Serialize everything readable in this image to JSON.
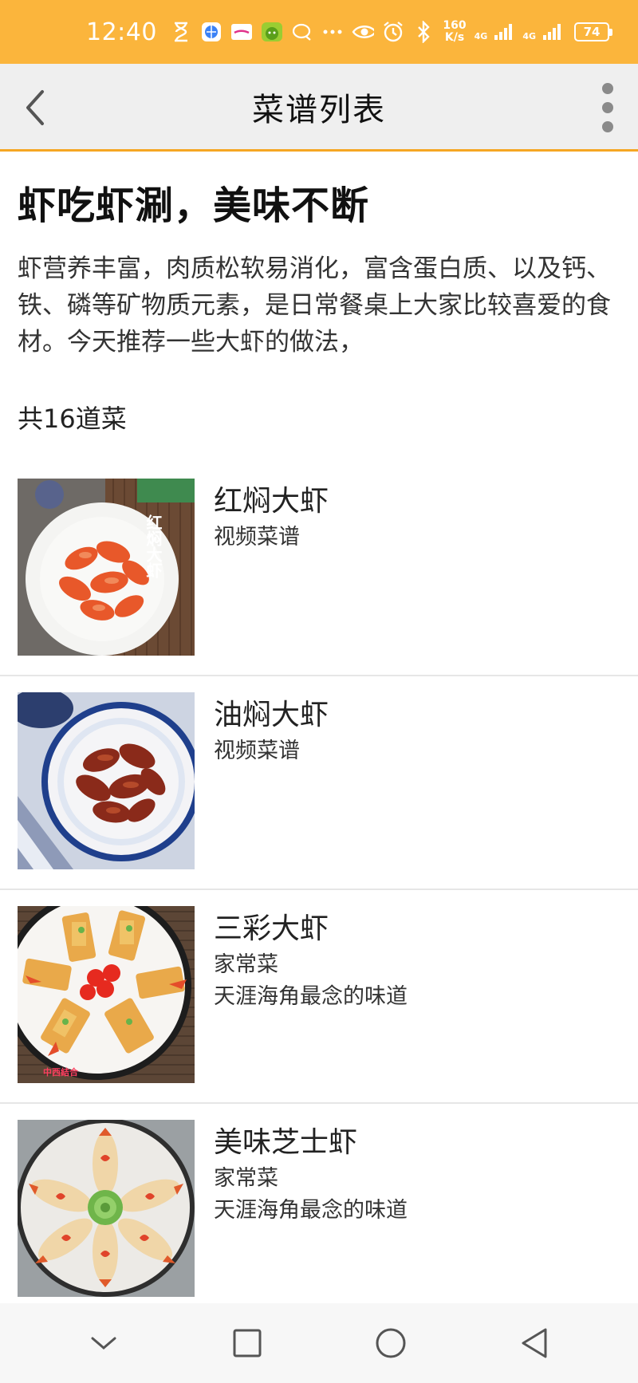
{
  "status_bar": {
    "time": "12:40",
    "speed_value": "160",
    "speed_unit": "K/s",
    "net_1": "4G",
    "net_2": "4G",
    "battery": "74"
  },
  "app_bar": {
    "title": "菜谱列表"
  },
  "intro": {
    "title": "虾吃虾涮，美味不断",
    "description": "虾营养丰富，肉质松软易消化，富含蛋白质、以及钙、铁、磷等矿物质元素，是日常餐桌上大家比较喜爱的食材。今天推荐一些大虾的做法，",
    "count": "共16道菜"
  },
  "recipes": [
    {
      "name": "红焖大虾",
      "tag": "视频菜谱",
      "author": "",
      "thumb_overlay": "红焖大虾"
    },
    {
      "name": "油焖大虾",
      "tag": "视频菜谱",
      "author": ""
    },
    {
      "name": "三彩大虾",
      "tag": "家常菜",
      "author": "天涯海角最念的味道",
      "thumb_overlay": "中西結合"
    },
    {
      "name": "美味芝士虾",
      "tag": "家常菜",
      "author": "天涯海角最念的味道"
    }
  ],
  "colors": {
    "status_bar": "#fbb53c",
    "app_bar": "#efefef",
    "accent_line": "#f5a623"
  }
}
